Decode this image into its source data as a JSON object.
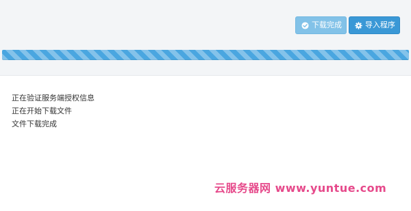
{
  "toolbar": {
    "download_complete_label": "下载完成",
    "import_program_label": "导入程序"
  },
  "progress": {
    "value_percent": 100
  },
  "log": {
    "lines": [
      "正在验证服务端授权信息",
      "正在开始下载文件",
      "文件下载完成"
    ]
  },
  "watermark": {
    "text": "云服务器网 www.yuntue.com"
  },
  "colors": {
    "background_top": "#f3f5f7",
    "progress_bar": "#4aa6e0",
    "button_primary": "#3a98d6",
    "button_disabled": "#7cc0e8",
    "watermark": "#e64a8b"
  },
  "icons": {
    "download_complete": "check-circle-icon",
    "import_program": "gear-icon"
  }
}
